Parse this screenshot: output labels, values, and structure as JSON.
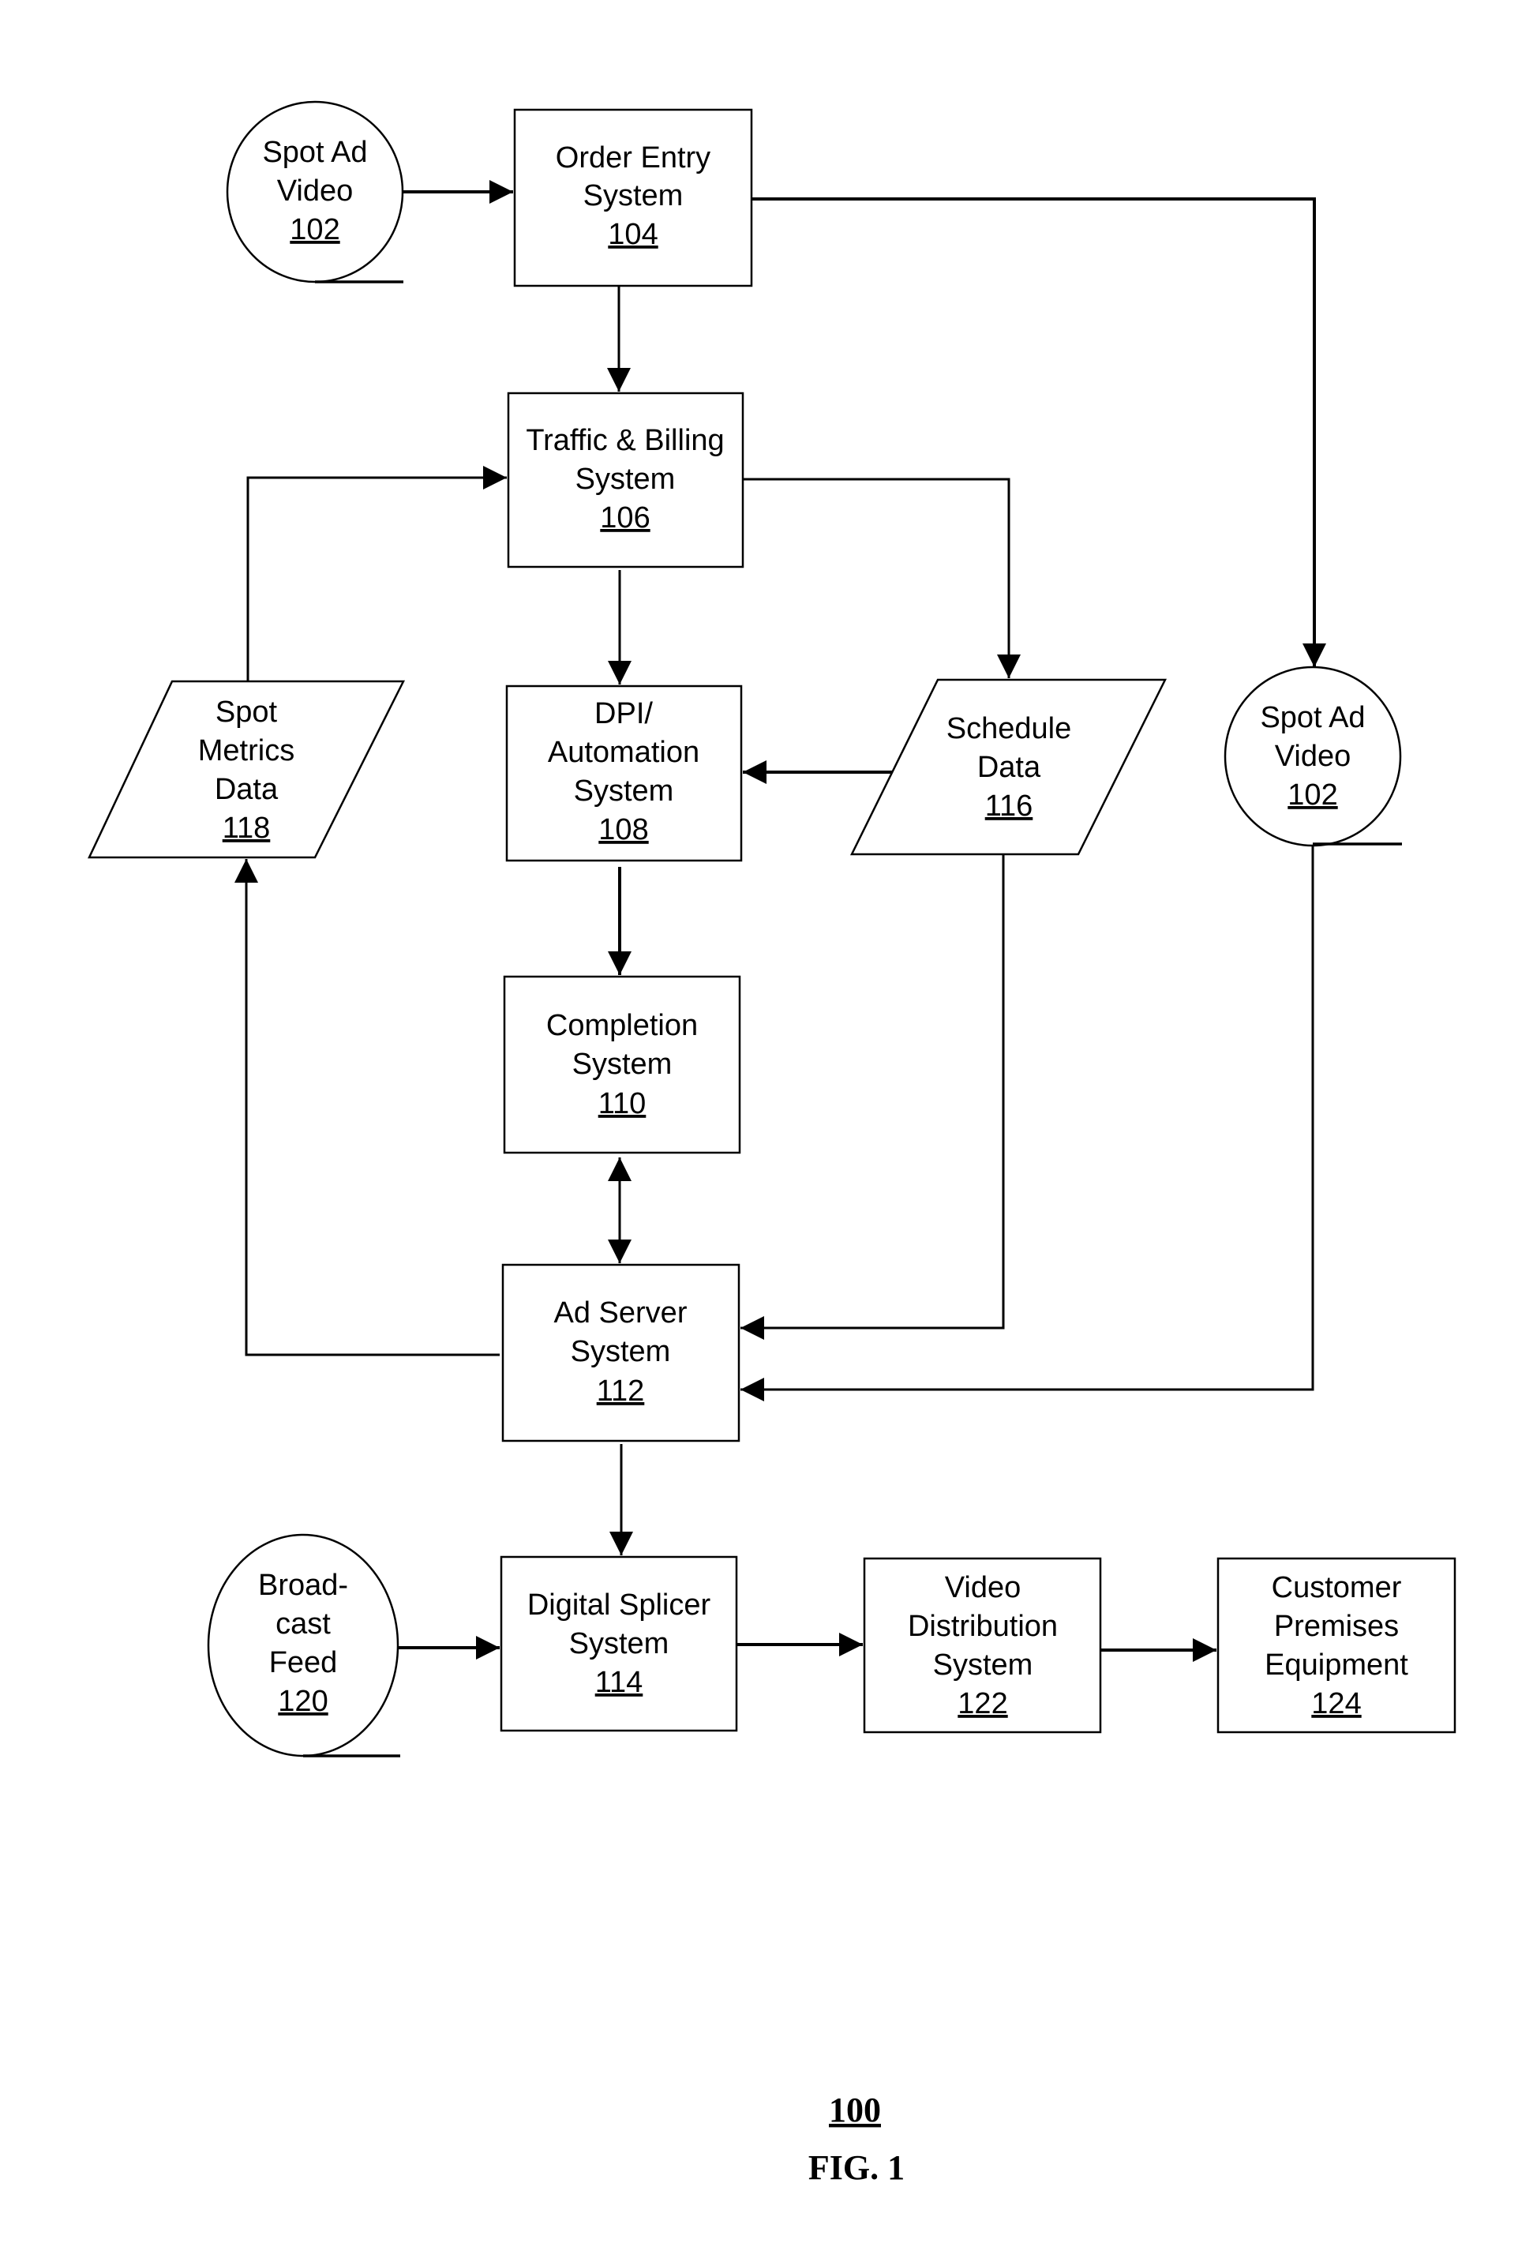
{
  "figure": {
    "reference": "100",
    "label": "FIG. 1"
  },
  "nodes": {
    "spot_ad_video_left": {
      "lines": [
        "Spot Ad",
        "Video"
      ],
      "ref": "102",
      "shape": "ellipse"
    },
    "order_entry": {
      "lines": [
        "Order Entry",
        "System"
      ],
      "ref": "104",
      "shape": "rect"
    },
    "traffic_billing": {
      "lines": [
        "Traffic & Billing",
        "System"
      ],
      "ref": "106",
      "shape": "rect"
    },
    "dpi_automation": {
      "lines": [
        "DPI/",
        "Automation",
        "System"
      ],
      "ref": "108",
      "shape": "rect"
    },
    "completion": {
      "lines": [
        "Completion",
        "System"
      ],
      "ref": "110",
      "shape": "rect"
    },
    "ad_server": {
      "lines": [
        "Ad Server",
        "System"
      ],
      "ref": "112",
      "shape": "rect"
    },
    "digital_splicer": {
      "lines": [
        "Digital Splicer",
        "System"
      ],
      "ref": "114",
      "shape": "rect"
    },
    "schedule_data": {
      "lines": [
        "Schedule",
        "Data"
      ],
      "ref": "116",
      "shape": "parallelogram"
    },
    "spot_metrics_data": {
      "lines": [
        "Spot",
        "Metrics",
        "Data"
      ],
      "ref": "118",
      "shape": "parallelogram"
    },
    "broadcast_feed": {
      "lines": [
        "Broad-",
        "cast",
        "Feed"
      ],
      "ref": "120",
      "shape": "ellipse"
    },
    "video_distribution": {
      "lines": [
        "Video",
        "Distribution",
        "System"
      ],
      "ref": "122",
      "shape": "rect"
    },
    "customer_premises": {
      "lines": [
        "Customer",
        "Premises",
        "Equipment"
      ],
      "ref": "124",
      "shape": "rect"
    },
    "spot_ad_video_right": {
      "lines": [
        "Spot Ad",
        "Video"
      ],
      "ref": "102",
      "shape": "ellipse"
    }
  },
  "edges": [
    {
      "from": "spot_ad_video_left",
      "to": "order_entry",
      "direction": "forward"
    },
    {
      "from": "order_entry",
      "to": "traffic_billing",
      "direction": "forward"
    },
    {
      "from": "order_entry",
      "to": "spot_ad_video_right",
      "direction": "forward"
    },
    {
      "from": "traffic_billing",
      "to": "dpi_automation",
      "direction": "forward"
    },
    {
      "from": "traffic_billing",
      "to": "schedule_data",
      "direction": "forward"
    },
    {
      "from": "spot_metrics_data",
      "to": "traffic_billing",
      "direction": "forward"
    },
    {
      "from": "schedule_data",
      "to": "dpi_automation",
      "direction": "forward"
    },
    {
      "from": "dpi_automation",
      "to": "completion",
      "direction": "forward"
    },
    {
      "from": "completion",
      "to": "ad_server",
      "direction": "bidirectional"
    },
    {
      "from": "schedule_data",
      "to": "ad_server",
      "direction": "forward"
    },
    {
      "from": "spot_ad_video_right",
      "to": "ad_server",
      "direction": "forward"
    },
    {
      "from": "ad_server",
      "to": "spot_metrics_data",
      "direction": "forward"
    },
    {
      "from": "ad_server",
      "to": "digital_splicer",
      "direction": "forward"
    },
    {
      "from": "broadcast_feed",
      "to": "digital_splicer",
      "direction": "forward"
    },
    {
      "from": "digital_splicer",
      "to": "video_distribution",
      "direction": "forward"
    },
    {
      "from": "video_distribution",
      "to": "customer_premises",
      "direction": "forward"
    }
  ]
}
